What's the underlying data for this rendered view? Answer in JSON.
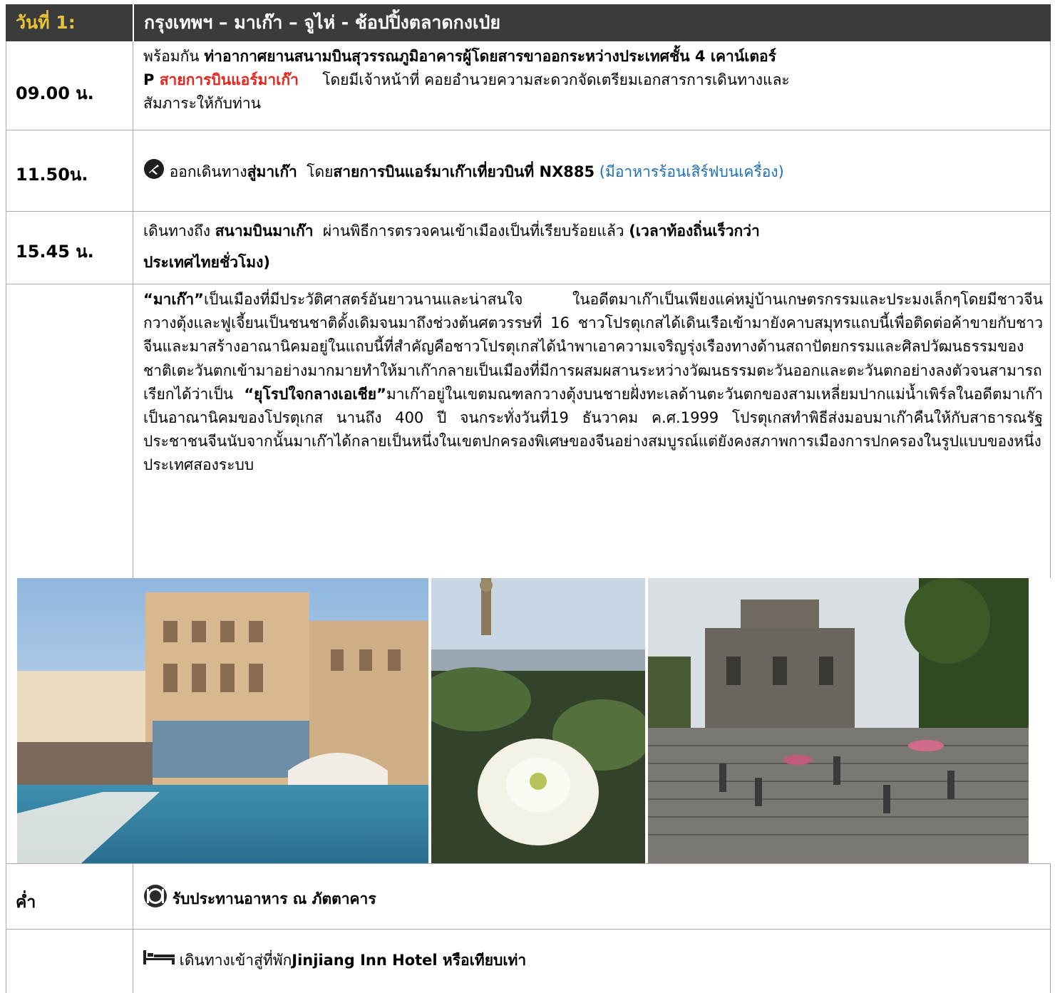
{
  "header": {
    "day": "วันที่ 1:",
    "route": "กรุงเทพฯ – มาเก๊า – จูไห่ - ช้อปปิ้งตลาดกงเป่ย"
  },
  "rows": [
    {
      "time": "09.00 น.",
      "line1_a": "พร้อมกัน ",
      "line1_b": "ท่าอากาศยานสนามบินสุวรรณภูมิอาคารผู้โดยสารขาออกระหว่างประเทศชั้น 4 เคาน์เตอร์",
      "line2_a": "P ",
      "line2_airline": "สายการบินแอร์มาเก๊า",
      "line2_b": "     โดยมีเจ้าหน้าที่ คอยอำนวยความสะดวกจัดเตรียมเอกสารการเดินทางและ",
      "line3": "สัมภาระให้กับท่าน"
    },
    {
      "time": "11.50น.",
      "a": " ออกเดินทาง",
      "b": "สู่มาเก๊า",
      "c": "  โดย",
      "d": "สายการบินแอร์มาเก๊าเที่ยวบินที่ NX885",
      "e": " (มีอาหารร้อนเสิร์ฟบนเครื่อง)",
      "icon": "airplane-icon"
    },
    {
      "time": "15.45 น.",
      "a": "เดินทางถึง ",
      "b": "สนามบินมาเก๊า",
      "c": "  ผ่านพิธีการตรวจคนเข้าเมืองเป็นที่เรียบร้อยแล้ว ",
      "d": "(เวลาท้องถิ่นเร็วกว่า",
      "line2": "ประเทศไทยชั่วโมง)"
    }
  ],
  "description": {
    "lead": "“มาเก๊า”",
    "part1": "เป็นเมืองที่มีประวัติศาสตร์อันยาวนานและน่าสนใจ ในอดีตมาเก๊าเป็นเพียงแค่หมู่บ้านเกษตรกรรมและประมงเล็กๆโดยมีชาวจีนกวางตุ้งและฟูเจี้ยนเป็นชนชาติดั้งเดิมจนมาถึงช่วงต้นศตวรรษที่ 16 ชาวโปรตุเกสได้เดินเรือเข้ามายังคาบสมุทรแถบนี้เพื่อติดต่อค้าขายกับชาวจีนและมาสร้างอาณานิคมอยู่ในแถบนี้ที่สำคัญคือชาวโปรตุเกสได้นำพาเอาความเจริญรุ่งเรืองทางด้านสถาปัตยกรรมและศิลปวัฒนธรรมของชาติเตะวันตกเข้ามาอย่างมากมายทำให้มาเก๊ากลายเป็นเมืองที่มีการผสมผสานระหว่างวัฒนธรรมตะวันออกและตะวันตกอย่างลงตัวจนสามารถเรียกได้ว่าเป็น ",
    "highlight": "“ยุโรปใจกลางเอเชีย”",
    "part2": "มาเก๊าอยู่ในเขตมณฑลกวางตุ้งบนชายฝั่งทะเลด้านตะวันตกของสามเหลี่ยมปากแม่น้ำเพิร์ลในอดีตมาเก๊าเป็นอาณานิคมของโปรตุเกส นานถึง 400 ปี จนกระทั่งวันที่19 ธันวาคม ค.ศ.1999 โปรตุเกสทำพิธีส่งมอบมาเก๊าคืนให้กับสาธารณรัฐประชาชนจีนนับจากนั้นมาเก๊าได้กลายเป็นหนึ่งในเขตปกครองพิเศษของจีนอย่างสมบูรณ์แต่ยังคงสภาพการเมืองการปกครองในรูปแบบของหนึ่งประเทศสองระบบ"
  },
  "photos": [
    "venetian-canal-photo",
    "guanyin-lotus-photo",
    "st-pauls-ruins-photo"
  ],
  "dinner": {
    "label": "ค่ำ",
    "text": "รับประทานอาหาร ณ ภัตตาคาร",
    "icon": "restaurant-icon"
  },
  "hotel": {
    "a": " เดินทางเข้าสู่ที่พัก",
    "b": "Jinjiang Inn Hotel",
    "c": " หรือเทียบเท่า",
    "icon": "bed-icon"
  },
  "colors": {
    "header_bg": "#3b3b3b",
    "day_label": "#e8c33a",
    "airline_red": "#e8231c",
    "meal_blue": "#1d6fb8"
  }
}
